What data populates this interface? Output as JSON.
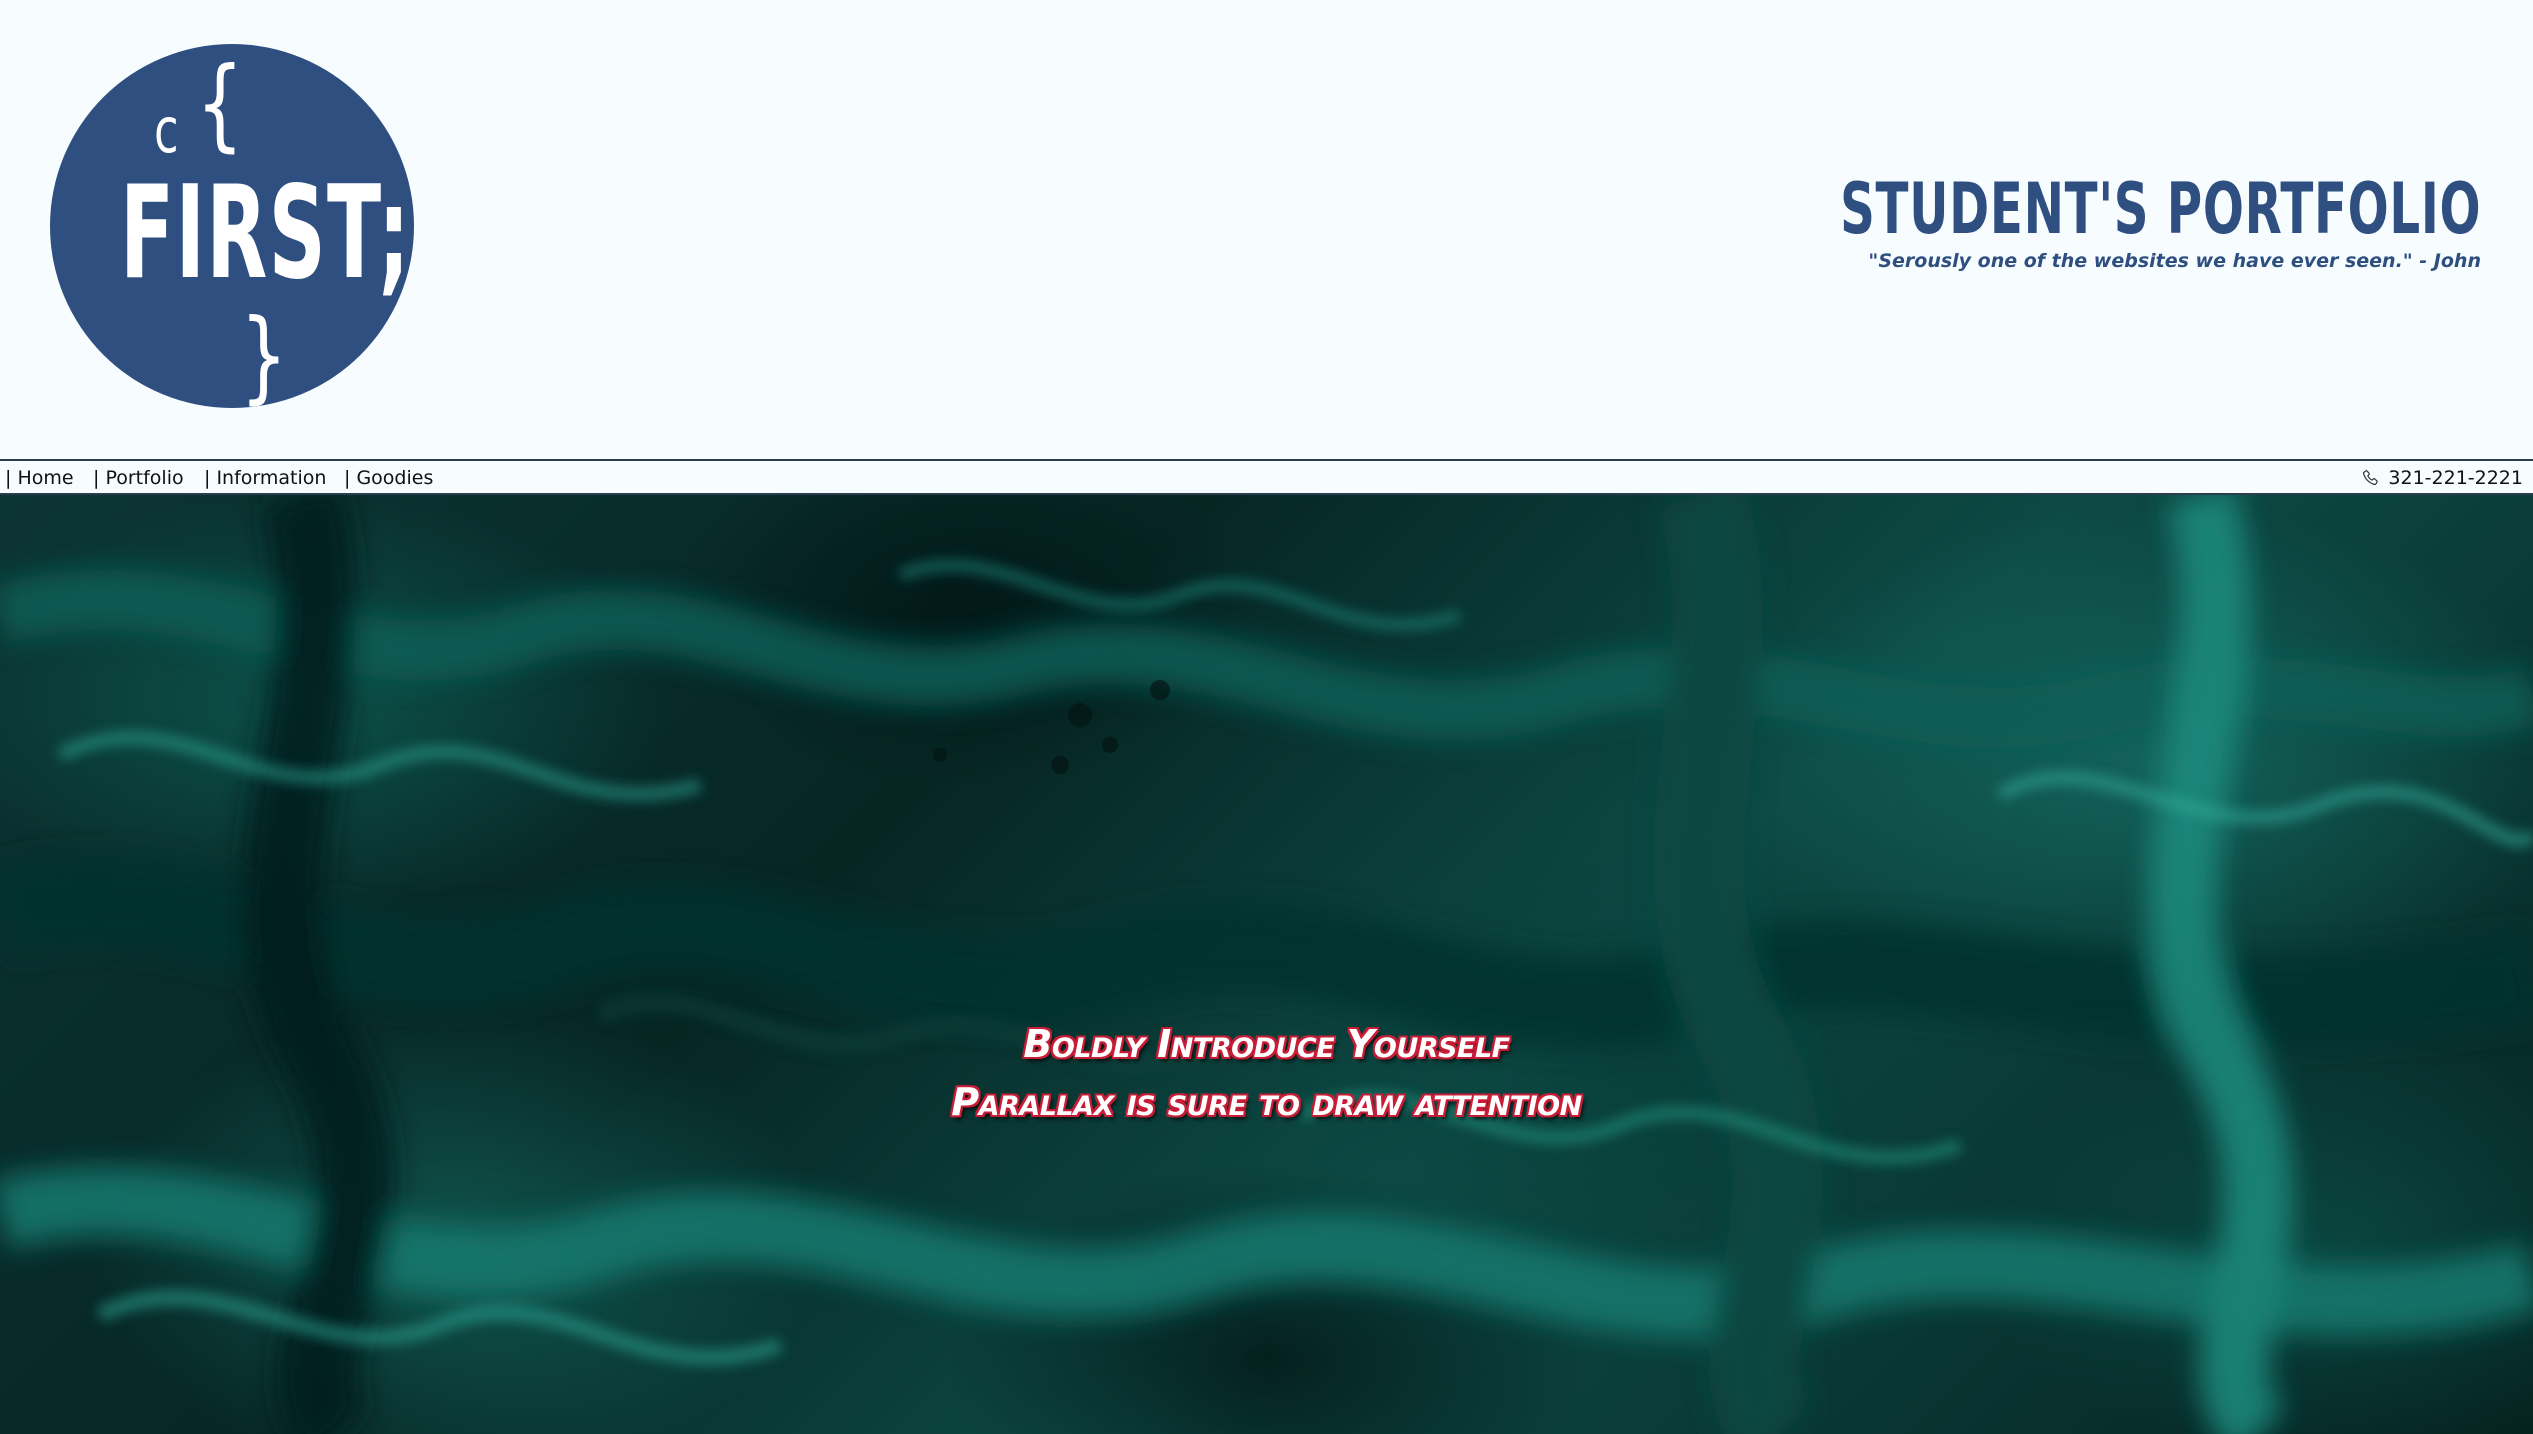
{
  "logo": {
    "small_letter": "c",
    "open_brace": "{",
    "main_text": "FIRST;",
    "close_brace": "}"
  },
  "header": {
    "title": "STUDENT'S PORTFOLIO",
    "quote": "\"Serously one of the websites we have ever seen.\" - John"
  },
  "nav": {
    "items": [
      {
        "label": "| Home"
      },
      {
        "label": "| Portfolio"
      },
      {
        "label": "| Information"
      },
      {
        "label": "| Goodies"
      }
    ],
    "phone": "321-221-2221",
    "phone_icon": "phone-icon"
  },
  "hero": {
    "line1": "Boldly Introduce Yourself",
    "line2": "Parallax is sure to draw attention"
  },
  "colors": {
    "brand_blue": "#2e4f80",
    "header_bg": "#f7fcff",
    "hero_teal": "#0b3533",
    "hero_text_outline": "#c81d36"
  }
}
